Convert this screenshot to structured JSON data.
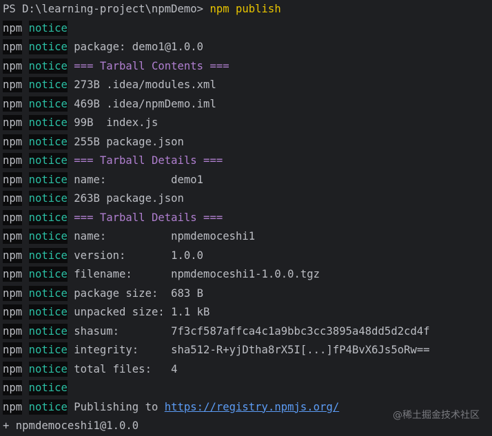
{
  "prompt": {
    "text": "PS D:\\learning-project\\npmDemo> ",
    "command": "npm publish",
    "command_color": "#e8c400"
  },
  "prefix": {
    "npm": "npm",
    "notice": "notice"
  },
  "lines": [
    {
      "text": "",
      "style": ""
    },
    {
      "text": "package: demo1@1.0.0",
      "style": ""
    },
    {
      "text": "=== Tarball Contents ===",
      "style": "purple"
    },
    {
      "text": "273B .idea/modules.xml",
      "style": ""
    },
    {
      "text": "469B .idea/npmDemo.iml",
      "style": ""
    },
    {
      "text": "99B  index.js",
      "style": ""
    },
    {
      "text": "255B package.json",
      "style": ""
    },
    {
      "text": "=== Tarball Details ===",
      "style": "purple"
    },
    {
      "text": "name:          demo1",
      "style": ""
    },
    {
      "text": "263B package.json",
      "style": ""
    },
    {
      "text": "=== Tarball Details ===",
      "style": "purple"
    },
    {
      "text": "name:          npmdemoceshi1",
      "style": ""
    },
    {
      "text": "version:       1.0.0",
      "style": ""
    },
    {
      "text": "filename:      npmdemoceshi1-1.0.0.tgz",
      "style": ""
    },
    {
      "text": "package size:  683 B",
      "style": ""
    },
    {
      "text": "unpacked size: 1.1 kB",
      "style": ""
    },
    {
      "text": "shasum:        7f3cf587affca4c1a9bbc3cc3895a48dd5d2cd4f",
      "style": ""
    },
    {
      "text": "integrity:     sha512-R+yjDtha8rX5I[...]fP4BvX6Js5oRw==",
      "style": ""
    },
    {
      "text": "total files:   4",
      "style": ""
    },
    {
      "text": "",
      "style": ""
    },
    {
      "text": "Publishing to ",
      "style": "",
      "link": "https://registry.npmjs.org/"
    }
  ],
  "result": "+ npmdemoceshi1@1.0.0",
  "watermark": "@稀土掘金技术社区"
}
